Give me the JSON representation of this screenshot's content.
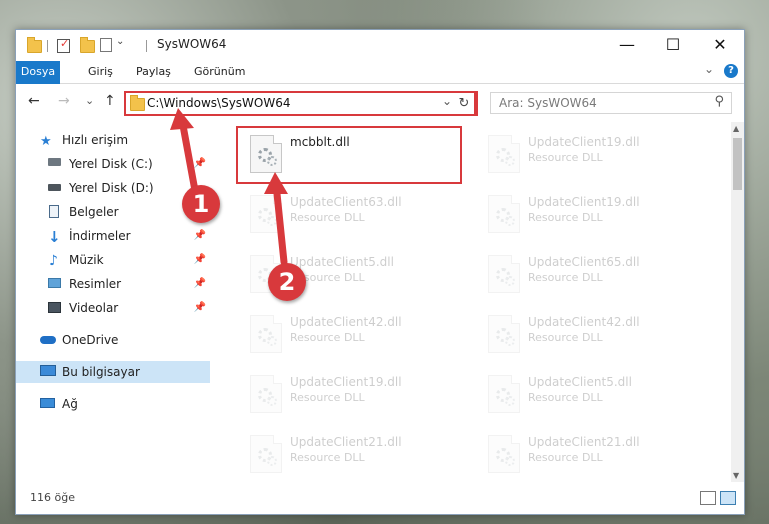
{
  "window": {
    "title": "SysWOW64",
    "controls": {
      "minimize": "—",
      "maximize": "☐",
      "close": "✕"
    }
  },
  "ribbon": {
    "tabs": [
      "Dosya",
      "Giriş",
      "Paylaş",
      "Görünüm"
    ],
    "collapse": "⌄",
    "help": "?"
  },
  "nav": {
    "back": "←",
    "forward": "→",
    "recent": "⌄",
    "up": "↑",
    "address": "C:\\Windows\\SysWOW64",
    "address_dropdown": "⌄",
    "refresh": "↻",
    "search_placeholder": "Ara: SysWOW64",
    "search_icon": "⚲"
  },
  "sidebar": {
    "items": [
      {
        "label": "Hızlı erişim",
        "icon": "star-icon",
        "pinned": false
      },
      {
        "label": "Yerel Disk (C:)",
        "icon": "drive-icon",
        "pinned": true
      },
      {
        "label": "Yerel Disk (D:)",
        "icon": "drive-icon",
        "pinned": false
      },
      {
        "label": "Belgeler",
        "icon": "documents-icon",
        "pinned": false
      },
      {
        "label": "İndirmeler",
        "icon": "download-icon",
        "pinned": true
      },
      {
        "label": "Müzik",
        "icon": "music-icon",
        "pinned": true
      },
      {
        "label": "Resimler",
        "icon": "pictures-icon",
        "pinned": true
      },
      {
        "label": "Videolar",
        "icon": "videos-icon",
        "pinned": true
      },
      {
        "label": "OneDrive",
        "icon": "cloud-icon",
        "pinned": false
      },
      {
        "label": "Bu bilgisayar",
        "icon": "computer-icon",
        "pinned": false,
        "selected": true
      },
      {
        "label": "Ağ",
        "icon": "network-icon",
        "pinned": false
      }
    ]
  },
  "files": [
    {
      "name": "mcbblt.dll",
      "type": "",
      "highlighted": true
    },
    {
      "name": "UpdateClient19.dll",
      "type": "Resource DLL"
    },
    {
      "name": "UpdateClient63.dll",
      "type": "Resource DLL"
    },
    {
      "name": "UpdateClient19.dll",
      "type": "Resource DLL"
    },
    {
      "name": "UpdateClient5.dll",
      "type": "Resource DLL"
    },
    {
      "name": "UpdateClient65.dll",
      "type": "Resource DLL"
    },
    {
      "name": "UpdateClient42.dll",
      "type": "Resource DLL"
    },
    {
      "name": "UpdateClient42.dll",
      "type": "Resource DLL"
    },
    {
      "name": "UpdateClient19.dll",
      "type": "Resource DLL"
    },
    {
      "name": "UpdateClient5.dll",
      "type": "Resource DLL"
    },
    {
      "name": "UpdateClient21.dll",
      "type": "Resource DLL"
    },
    {
      "name": "UpdateClient21.dll",
      "type": "Resource DLL"
    }
  ],
  "status": {
    "count": "116 öğe"
  },
  "annotations": {
    "step1": "1",
    "step2": "2",
    "color": "#d8393c"
  }
}
